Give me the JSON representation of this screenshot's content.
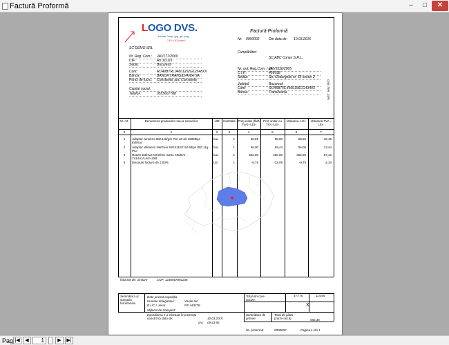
{
  "window": {
    "title": "Factură Proformă",
    "minimize": "–",
    "maximize": "□",
    "close": "✕"
  },
  "logo": {
    "l": "L",
    "o": "O",
    "rest": "GO DVS.",
    "formats": "format .bmp,.jpg,.gif,.png",
    "size": "218 x 53 pixeli"
  },
  "invoice": {
    "title": "Factură Proformă",
    "nr_label": "Nr.",
    "nr": "0000002",
    "date_label": "Din data de:",
    "date": "10.03.2015"
  },
  "supplier": {
    "name": "SC DEMO SRL",
    "rows": [
      {
        "label": "Nr. Reg. Com.:",
        "value": "J40/177/2009"
      },
      {
        "label": "CIF:",
        "value": "Ro 111111"
      },
      {
        "label": "Sediu:",
        "value": "Bucuresti"
      },
      {
        "label": "Cont:",
        "value": "RO49BTRL04601202G12548XX"
      },
      {
        "label": "Banca:",
        "value": "BANCA TRANSILVANIA SA"
      },
      {
        "label": "Punct de lucru:",
        "value": "Constanta, jud. Constanta"
      },
      {
        "label": "Capital social:",
        "value": ""
      },
      {
        "label": "Telefon:",
        "value": "0555667788"
      }
    ]
  },
  "buyer": {
    "title": "Cumpărător:",
    "name": "SC ABC Conex S.R.L.",
    "rows": [
      {
        "label": "Nr. ord. Reg.Com. / an:",
        "value": "J40/5536/2005"
      },
      {
        "label": "C.I.F.:",
        "value": "456698"
      },
      {
        "label": "Sediul:",
        "value": "Str. Gheorghiei nr. 55 sector 2"
      },
      {
        "label": "Județul:",
        "value": "Bucuresti"
      },
      {
        "label": "Cont:",
        "value": "RO45BTRL4566156CG4340X"
      },
      {
        "label": "Banca:",
        "value": "Transilvania"
      }
    ]
  },
  "side_note": "cota TVA: 24%",
  "table": {
    "headers": [
      "Nr. crt.",
      "Denumirea produselor sau a serviciilor",
      "UM",
      "Cantitate",
      "Preț unitar (fără TVA) -LEI-",
      "Preț unitar cu TVA -LEI-",
      "Valoarea -LEI-",
      "Valoarea TVA -LEI-"
    ],
    "col_nums": [
      "0",
      "1",
      "2",
      "3",
      "4",
      "5",
      "6",
      "7"
    ],
    "rows": [
      {
        "nr": "1",
        "name": [
          "Adaptor wireless 802.11b/g/n PCI 32-bit 150Mbps",
          "Edimax"
        ],
        "um": "buc",
        "qty": "1",
        "pu": "68,55",
        "pu_tva": "85,00",
        "val": "68,55",
        "tva": "16,45"
      },
      {
        "nr": "2",
        "name": [
          "Adaptor Wireless NetGear WG311EE 54 Mbps 802.11g",
          "PCI"
        ],
        "um": "buc",
        "qty": "1",
        "pu": "56,00",
        "pu_tva": "69,44",
        "val": "56,00",
        "tva": "13,44"
      },
      {
        "nr": "3",
        "name": [
          "Router Edimax Wireless ADSL Modem",
          "7414A1/LAN-USB"
        ],
        "um": "buc",
        "qty": "1",
        "pu": "362,90",
        "pu_tva": "450,00",
        "val": "362,90",
        "tva": "87,10"
      },
      {
        "nr": "4",
        "name": [
          "Discount factura de 2,00%"
        ],
        "um": "LEI",
        "qty": "1",
        "pu": "-9,75",
        "pu_tva": "-12,09",
        "val": "-9,75",
        "tva": "-2,34"
      }
    ]
  },
  "intocmit": {
    "label": "Întocmit de: amitare",
    "cnp": "CNP: 1236567891236"
  },
  "footer": {
    "sign_label": "Semnătura și ștampila furnizorului",
    "delegat_title": "Date privind expediția",
    "delegat_name_label": "Numele delegatului:",
    "delegat_name": "Vasile Ion",
    "ci_label": "B.I./C.I. seria:",
    "ci": "RX 443378",
    "transport": "Mijlocul de transport:",
    "expedition_label": "Expedierea s-a efectuat în prezența noastră la data de:",
    "exp_date": "10.03.2015",
    "ora_label": "ora:",
    "ora": "09:43:55",
    "total_label": "Total din care accize:",
    "total_val": "477,70",
    "total_tva": "114,65",
    "x_mark": "X",
    "recv_sign": "Semnătura de primire",
    "pay_label": "Total de plată (col.5+col.6)",
    "pay_val": "592,35",
    "nr_label": "Nr. proformă:",
    "nr": "0000002",
    "page_label": "Pagina 1 din 1"
  },
  "statusbar": {
    "label": "Page:",
    "first": "|◀",
    "prev": "◀",
    "current": "1",
    "next": "▶",
    "last": "▶|"
  }
}
